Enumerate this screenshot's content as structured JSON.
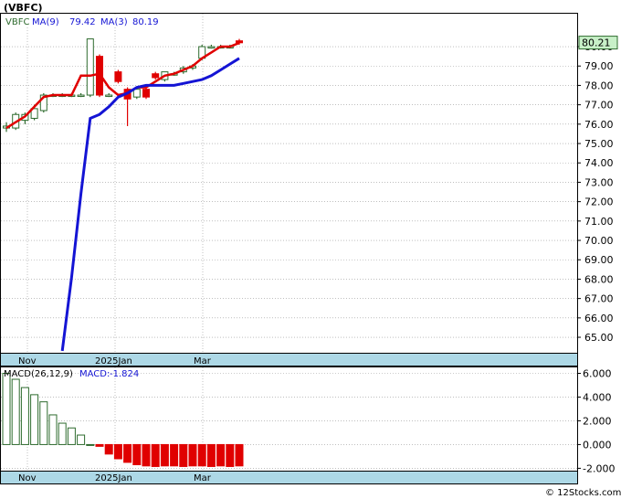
{
  "chart_data": [
    {
      "type": "candlestick",
      "title": "(VBFC)",
      "legend": {
        "symbol": "VBFC",
        "ma9_label": "MA(9)",
        "ma9_value": "79.42",
        "ma3_label": "MA(3)",
        "ma3_value": "80.19"
      },
      "last_price_label": "80.21",
      "ylim": [
        64.2,
        81.7
      ],
      "y_ticks": [
        "65.00",
        "66.00",
        "67.00",
        "68.00",
        "69.00",
        "70.00",
        "71.00",
        "72.00",
        "73.00",
        "74.00",
        "75.00",
        "76.00",
        "77.00",
        "78.00",
        "79.00",
        "80.00"
      ],
      "x_labels": [
        "Nov",
        "2025Jan",
        "Mar"
      ],
      "grid": true,
      "colors": {
        "up": "#2e6b2e",
        "down": "#e00000",
        "ma9": "#1414d4",
        "ma3": "#e00000",
        "axis_band": "#add8e6"
      },
      "candles": [
        {
          "open": 75.8,
          "high": 76.1,
          "low": 75.6,
          "close": 75.9
        },
        {
          "open": 75.8,
          "high": 76.6,
          "low": 75.7,
          "close": 76.5
        },
        {
          "open": 76.2,
          "high": 76.6,
          "low": 76.0,
          "close": 76.5
        },
        {
          "open": 76.3,
          "high": 77.0,
          "low": 76.2,
          "close": 76.8
        },
        {
          "open": 76.7,
          "high": 77.6,
          "low": 76.6,
          "close": 77.5
        },
        {
          "open": 77.5,
          "high": 77.6,
          "low": 77.4,
          "close": 77.5
        },
        {
          "open": 77.5,
          "high": 77.6,
          "low": 77.4,
          "close": 77.5
        },
        {
          "open": 77.5,
          "high": 77.6,
          "low": 77.4,
          "close": 77.5
        },
        {
          "open": 77.5,
          "high": 77.6,
          "low": 77.4,
          "close": 77.5
        },
        {
          "open": 77.5,
          "high": 80.4,
          "low": 77.4,
          "close": 80.4
        },
        {
          "open": 79.5,
          "high": 79.6,
          "low": 77.4,
          "close": 77.5
        },
        {
          "open": 77.5,
          "high": 77.6,
          "low": 77.4,
          "close": 77.5
        },
        {
          "open": 78.7,
          "high": 78.8,
          "low": 78.1,
          "close": 78.2
        },
        {
          "open": 77.8,
          "high": 77.9,
          "low": 75.9,
          "close": 77.3
        },
        {
          "open": 77.4,
          "high": 77.9,
          "low": 77.3,
          "close": 77.8
        },
        {
          "open": 77.8,
          "high": 77.9,
          "low": 77.3,
          "close": 77.4
        },
        {
          "open": 78.6,
          "high": 78.7,
          "low": 78.3,
          "close": 78.4
        },
        {
          "open": 78.3,
          "high": 78.7,
          "low": 78.2,
          "close": 78.7
        },
        {
          "open": 78.6,
          "high": 78.7,
          "low": 78.5,
          "close": 78.6
        },
        {
          "open": 78.7,
          "high": 79.0,
          "low": 78.6,
          "close": 78.9
        },
        {
          "open": 78.9,
          "high": 79.1,
          "low": 78.8,
          "close": 79.0
        },
        {
          "open": 79.4,
          "high": 80.1,
          "low": 79.3,
          "close": 80.0
        },
        {
          "open": 80.0,
          "high": 80.1,
          "low": 79.9,
          "close": 80.0
        },
        {
          "open": 80.0,
          "high": 80.1,
          "low": 79.9,
          "close": 80.0
        },
        {
          "open": 80.0,
          "high": 80.1,
          "low": 79.9,
          "close": 80.0
        },
        {
          "open": 80.3,
          "high": 80.4,
          "low": 80.1,
          "close": 80.2
        }
      ],
      "ma9": [
        64.3,
        68.1,
        72.4,
        76.3,
        76.5,
        76.9,
        77.4,
        77.6,
        77.9,
        78.0,
        78.0,
        78.0,
        78.0,
        78.1,
        78.2,
        78.3,
        78.5,
        78.8,
        79.1,
        79.4
      ],
      "ma3": [
        75.8,
        76.1,
        76.4,
        76.9,
        77.4,
        77.5,
        77.5,
        77.5,
        78.5,
        78.5,
        78.6,
        77.9,
        77.5,
        77.6,
        77.9,
        77.9,
        78.2,
        78.5,
        78.6,
        78.8,
        79.0,
        79.4,
        79.7,
        80.0,
        80.0,
        80.19
      ]
    },
    {
      "type": "bar",
      "title": "MACD(26,12,9)",
      "value_label": "MACD:",
      "value": "-1.824",
      "ylim": [
        -2.2,
        6.5
      ],
      "y_ticks": [
        "6.000",
        "4.000",
        "2.000",
        "0.000",
        "-2.000"
      ],
      "x_labels": [
        "Nov",
        "2025Jan",
        "Mar"
      ],
      "values": [
        6.0,
        5.5,
        4.8,
        4.2,
        3.6,
        2.5,
        1.8,
        1.4,
        0.8,
        0.0,
        -0.15,
        -0.8,
        -1.2,
        -1.5,
        -1.7,
        -1.8,
        -1.85,
        -1.8,
        -1.8,
        -1.85,
        -1.8,
        -1.8,
        -1.85,
        -1.8,
        -1.85,
        -1.8
      ],
      "colors": {
        "up": "#2e6b2e",
        "down": "#e00000"
      }
    }
  ],
  "footer": {
    "copyright": "© 12Stocks.com"
  }
}
